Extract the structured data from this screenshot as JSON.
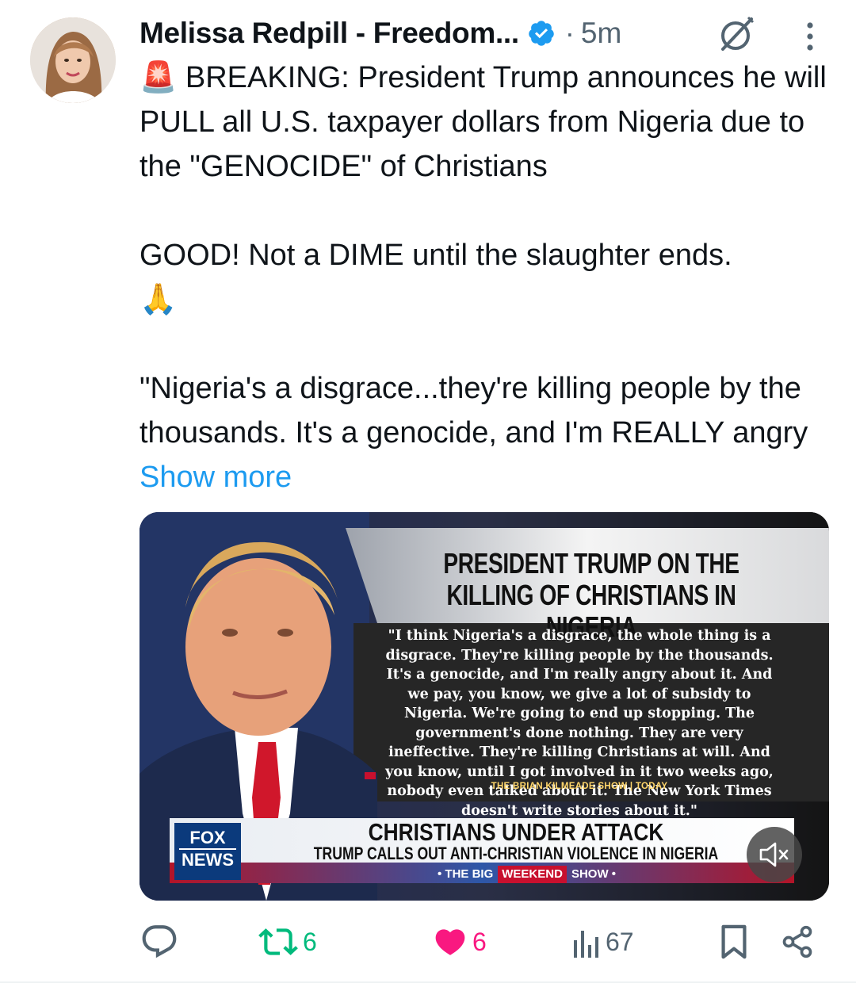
{
  "post": {
    "author_name": "Melissa Redpill - Freedom...",
    "separator": "·",
    "timestamp": "5m",
    "text_siren": "🚨",
    "text_breaking": " BREAKING: President Trump announces he will PULL all U.S. taxpayer dollars from Nigeria due to the \"GENOCIDE\" of Christians\n\nGOOD! Not a DIME until the slaughter ends.\n",
    "text_pray": "🙏",
    "text_quote": "\n\n\"Nigeria's a disgrace...they're killing people by the thousands. It's a genocide, and I'm REALLY angry ",
    "show_more": "Show more"
  },
  "media": {
    "headline": "PRESIDENT TRUMP ON THE KILLING OF CHRISTIANS IN NIGERIA",
    "quote": "\"I think Nigeria's a disgrace, the whole thing is a disgrace. They're killing people by the thousands. It's a genocide, and I'm really angry about it. And we pay, you know, we give a lot of subsidy to Nigeria. We're going to end up stopping. The government's done nothing. They are very ineffective. They're killing Christians at will. And you know, until I got involved in it two weeks ago, nobody even talked about it. The New York Times doesn't write stories about it.\"",
    "credit": "THE BRIAN KILMEADE SHOW | TODAY",
    "lower_title": "CHRISTIANS UNDER ATTACK",
    "lower_sub": "TRUMP CALLS OUT ANTI-CHRISTIAN VIOLENCE IN NIGERIA",
    "show_prefix": "• THE BIG",
    "show_highlight": "WEEKEND",
    "show_suffix": "SHOW •",
    "logo_line1": "FOX",
    "logo_line2": "NEWS"
  },
  "actions": {
    "reposts": "6",
    "likes": "6",
    "views": "67"
  },
  "colors": {
    "link": "#1d9bf0",
    "verified": "#1d9bf0",
    "like": "#f91880",
    "repost": "#00ba7c",
    "muted": "#536471"
  }
}
